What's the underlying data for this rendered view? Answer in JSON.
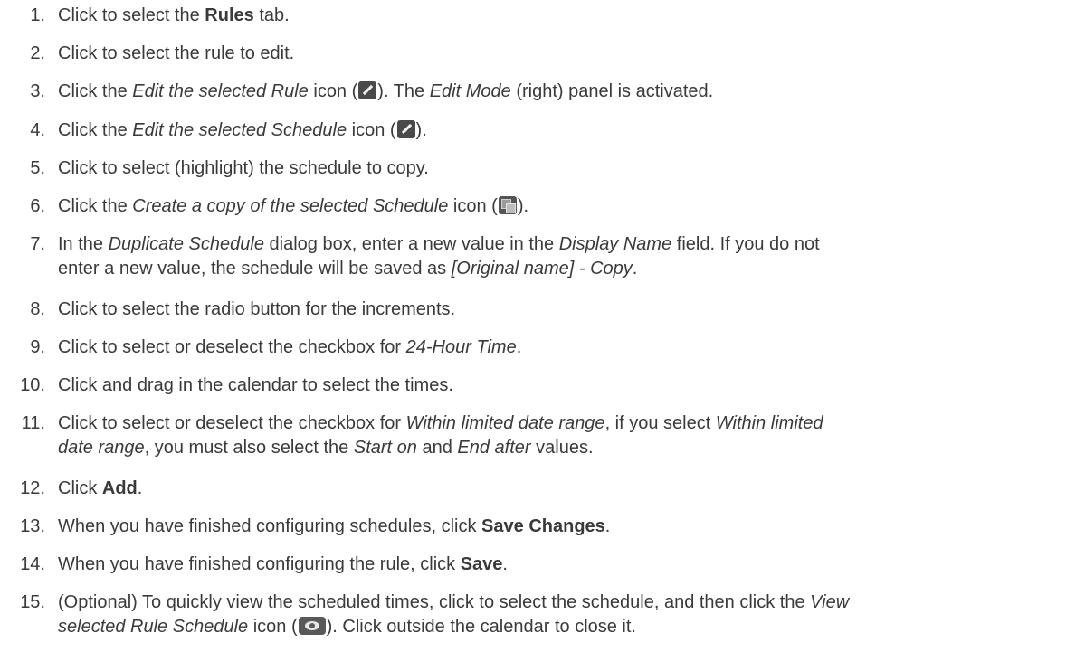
{
  "steps": [
    {
      "n": "1.",
      "a": "Click to select the ",
      "b": "Rules",
      "c": " tab."
    },
    {
      "n": "2.",
      "a": "Click to select the rule to edit."
    },
    {
      "n": "3.",
      "a": "Click the ",
      "b": "Edit the selected Rule",
      "c": " icon (",
      "d": "). The ",
      "e": "Edit Mode",
      "f": " (right) panel is activated."
    },
    {
      "n": "4.",
      "a": "Click the ",
      "b": "Edit the selected Schedule",
      "c": " icon (",
      "d": ")."
    },
    {
      "n": "5.",
      "a": "Click to select (highlight) the schedule to copy."
    },
    {
      "n": "6.",
      "a": "Click the ",
      "b": "Create a copy of the selected Schedule",
      "c": " icon (",
      "d": ")."
    },
    {
      "n": "7.",
      "a": "In the ",
      "b": "Duplicate Schedule",
      "c": " dialog box, enter a new value in the ",
      "d": "Display Name",
      "e": " field. If you do not",
      "f": "enter a new value, the schedule will be saved as ",
      "g": "[Original name] - Copy",
      "h": "."
    },
    {
      "n": "8.",
      "a": "Click to select the radio button for the increments."
    },
    {
      "n": "9.",
      "a": "Click to select or deselect the checkbox for ",
      "b": "24-Hour Time",
      "c": "."
    },
    {
      "n": "10.",
      "a": "Click and drag in the calendar to select the times."
    },
    {
      "n": "11.",
      "a": "Click to select or deselect the checkbox for ",
      "b": "Within limited date range",
      "c": ", if you select ",
      "d": "Within limited",
      "e": "date range",
      "f": ", you must also select the ",
      "g": "Start on",
      "h": " and ",
      "i": "End after",
      "j": " values."
    },
    {
      "n": "12.",
      "a": "Click ",
      "b": "Add",
      "c": "."
    },
    {
      "n": "13.",
      "a": "When you have finished configuring schedules, click ",
      "b": "Save Changes",
      "c": "."
    },
    {
      "n": "14.",
      "a": "When you have finished configuring the rule, click ",
      "b": "Save",
      "c": "."
    },
    {
      "n": "15.",
      "a": "(Optional) To quickly view the scheduled times, click to select the schedule, and then click the ",
      "b": "View",
      "c": "selected Rule Schedule",
      "d": " icon (",
      "e": "). Click outside the calendar to close it."
    }
  ],
  "icons": {
    "edit": "pencil-icon",
    "copy": "copy-icon",
    "view": "eye-icon"
  }
}
